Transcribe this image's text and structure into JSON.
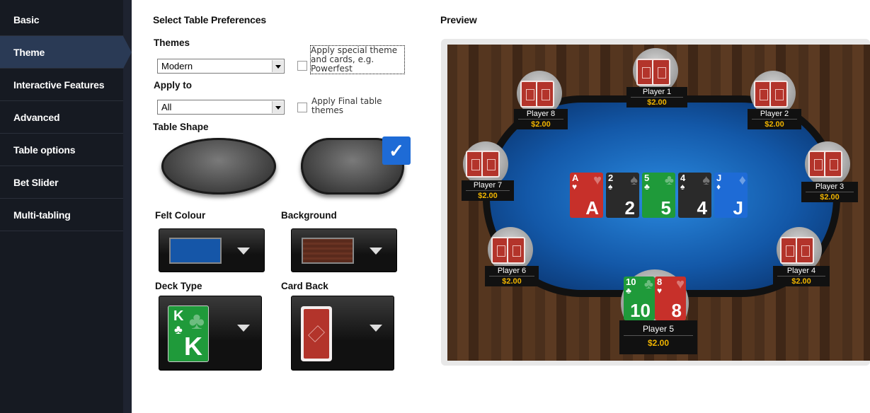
{
  "sidebar": {
    "items": [
      {
        "label": "Basic"
      },
      {
        "label": "Theme"
      },
      {
        "label": "Interactive Features"
      },
      {
        "label": "Advanced"
      },
      {
        "label": "Table options"
      },
      {
        "label": "Bet Slider"
      },
      {
        "label": "Multi-tabling"
      }
    ],
    "active_index": 1
  },
  "main": {
    "title": "Select Table Preferences",
    "themes_label": "Themes",
    "themes_value": "Modern",
    "special_theme_label": "Apply special theme and cards, e.g. Powerfest",
    "apply_to_label": "Apply to",
    "apply_to_value": "All",
    "final_table_label": "Apply Final table themes",
    "table_shape_label": "Table Shape",
    "felt_colour_label": "Felt Colour",
    "background_label": "Background",
    "deck_type_label": "Deck Type",
    "card_back_label": "Card Back",
    "deck_sample": {
      "rank": "K",
      "suit": "♣"
    },
    "colors": {
      "felt": "#1556a8",
      "background": "#5a2a1c",
      "deck": "#1f9a3a",
      "accent": "#1e6bd6"
    }
  },
  "preview": {
    "title": "Preview",
    "community_cards": [
      {
        "rank": "A",
        "suit": "♥",
        "color": "#c7302a"
      },
      {
        "rank": "2",
        "suit": "♠",
        "color": "#2a2a2a"
      },
      {
        "rank": "5",
        "suit": "♣",
        "color": "#1f9a3a"
      },
      {
        "rank": "4",
        "suit": "♠",
        "color": "#2a2a2a"
      },
      {
        "rank": "J",
        "suit": "♦",
        "color": "#1e6bd6"
      }
    ],
    "hero_cards": [
      {
        "rank": "10",
        "suit": "♣",
        "color": "#1f9a3a"
      },
      {
        "rank": "8",
        "suit": "♥",
        "color": "#c7302a"
      }
    ],
    "players": [
      {
        "name": "Player 1",
        "stack": "$2.00"
      },
      {
        "name": "Player 2",
        "stack": "$2.00"
      },
      {
        "name": "Player 3",
        "stack": "$2.00"
      },
      {
        "name": "Player 4",
        "stack": "$2.00"
      },
      {
        "name": "Player 5",
        "stack": "$2.00"
      },
      {
        "name": "Player 6",
        "stack": "$2.00"
      },
      {
        "name": "Player 7",
        "stack": "$2.00"
      },
      {
        "name": "Player 8",
        "stack": "$2.00"
      }
    ]
  }
}
